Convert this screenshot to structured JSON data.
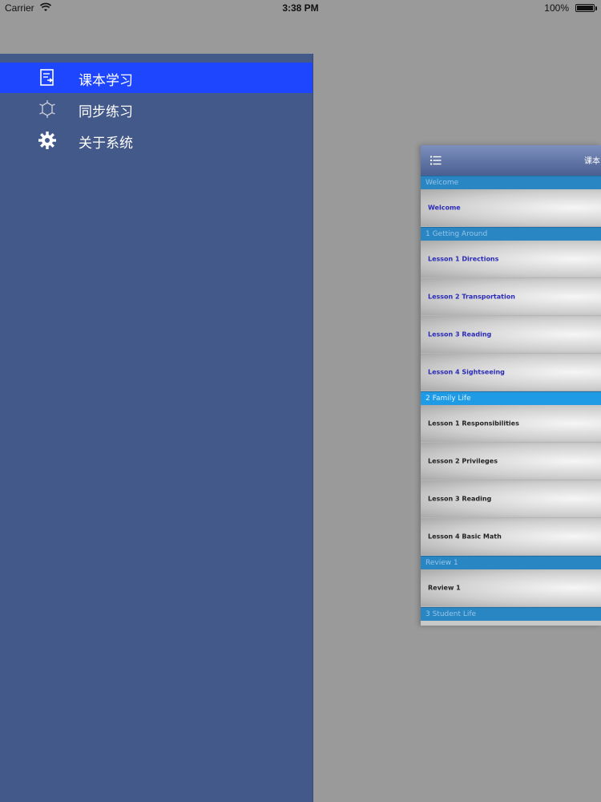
{
  "status_bar": {
    "carrier": "Carrier",
    "time": "3:38 PM",
    "battery": "100%",
    "battery_level": 1.0
  },
  "menu": {
    "items": [
      {
        "label": "课本学习",
        "icon": "book-icon",
        "active": true
      },
      {
        "label": "同步练习",
        "icon": "sun-outline-icon",
        "active": false
      },
      {
        "label": "关于系统",
        "icon": "gear-icon",
        "active": false
      }
    ]
  },
  "preview": {
    "title": "课本",
    "sections": [
      {
        "header": "Welcome",
        "rows": [
          {
            "label": "Welcome"
          }
        ]
      },
      {
        "header": "1 Getting Around",
        "rows": [
          {
            "label": "Lesson 1 Directions"
          },
          {
            "label": "Lesson 2 Transportation"
          },
          {
            "label": "Lesson 3 Reading"
          },
          {
            "label": "Lesson 4 Sightseeing"
          }
        ]
      },
      {
        "header": "2 Family Life",
        "rows": [
          {
            "label": "Lesson 1 Responsibilities"
          },
          {
            "label": "Lesson 2 Privileges"
          },
          {
            "label": "Lesson 3 Reading"
          },
          {
            "label": "Lesson 4 Basic Math"
          }
        ]
      },
      {
        "header": "Review 1",
        "rows": [
          {
            "label": "Review 1"
          }
        ]
      },
      {
        "header": "3 Student Life",
        "rows": []
      }
    ]
  },
  "colors": {
    "drawer_bg": "#43598a",
    "active_item": "#1e46ff",
    "section_header": "#2a86c2",
    "link_text": "#2a2ab8"
  }
}
